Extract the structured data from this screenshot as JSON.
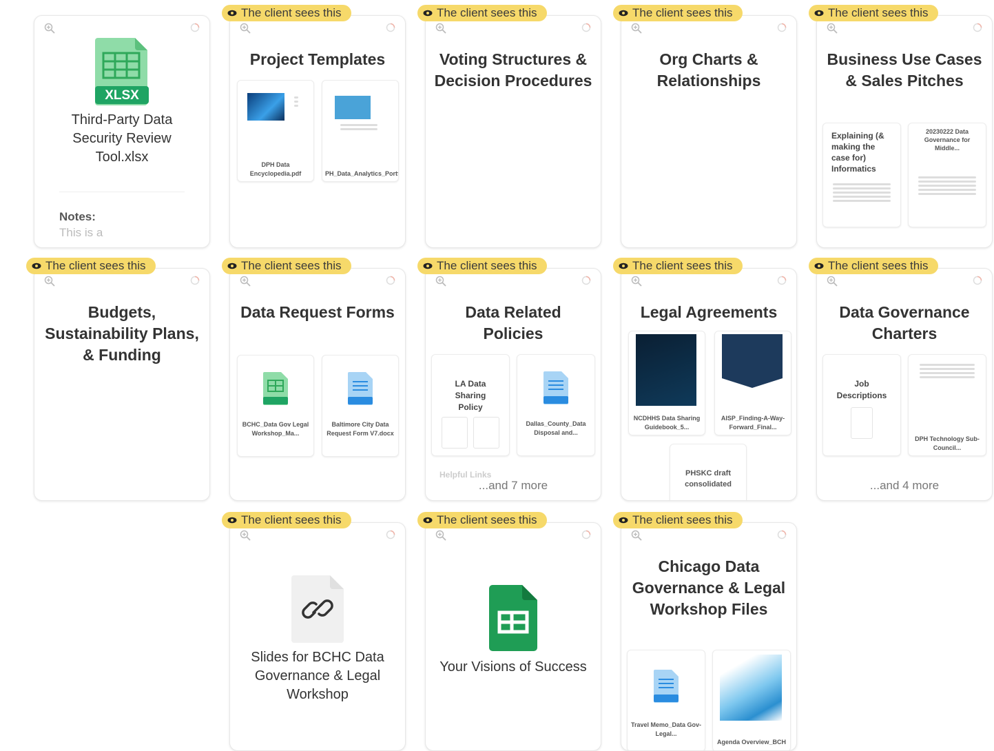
{
  "badge_text": "The client sees this",
  "colors": {
    "badge": "#f6d96a",
    "xlsx_green": "#1fa463",
    "docx_blue": "#2a8ce0",
    "sheets_green": "#1f9d55"
  },
  "cards": {
    "c1": {
      "title": "Third-Party Data Security Review Tool.xlsx",
      "filetype": "XLSX",
      "notes_label": "Notes:",
      "notes_text": "This is a"
    },
    "c2": {
      "title": "Project Templates",
      "thumbs": [
        "DPH Data Encyclopedia.pdf",
        "PH_Data_Analytics_Portfolio.pdf"
      ]
    },
    "c3": {
      "title": "Voting Structures & Decision Procedures"
    },
    "c4": {
      "title": "Org Charts & Relationships"
    },
    "c5": {
      "title": "Business Use Cases & Sales Pitches",
      "thumbs": [
        "Explaining (& making the case for) Informatics",
        "20230222 Data Governance for Middle..."
      ]
    },
    "c6": {
      "title": "Budgets, Sustainability Plans, & Funding"
    },
    "c7": {
      "title": "Data Request Forms",
      "thumbs": [
        "BCHC_Data Gov Legal Workshop_Ma...",
        "Baltimore City Data Request Form V7.docx"
      ]
    },
    "c8": {
      "title": "Data Related Policies",
      "thumbs": [
        "LA Data Sharing Policy",
        "Dallas_County_Data Disposal and..."
      ],
      "more": "...and 7 more",
      "extra": "Helpful Links"
    },
    "c9": {
      "title": "Legal Agreements",
      "thumbs": [
        "NCDHHS Data Sharing Guidebook_5...",
        "AISP_Finding-A-Way-Forward_Final...",
        "PHSKC draft consolidated"
      ]
    },
    "c10": {
      "title": "Data Governance Charters",
      "thumbs": [
        "Job Descriptions",
        "DPH Technology Sub-Council..."
      ],
      "more": "...and 4 more"
    },
    "c11": {
      "title": "Slides for BCHC Data Governance & Legal Workshop"
    },
    "c12": {
      "title": "Your Visions of Success"
    },
    "c13": {
      "title": "Chicago Data Governance & Legal Workshop Files",
      "thumbs": [
        "Travel Memo_Data Gov-Legal...",
        "Agenda Overview_BCH"
      ]
    }
  }
}
